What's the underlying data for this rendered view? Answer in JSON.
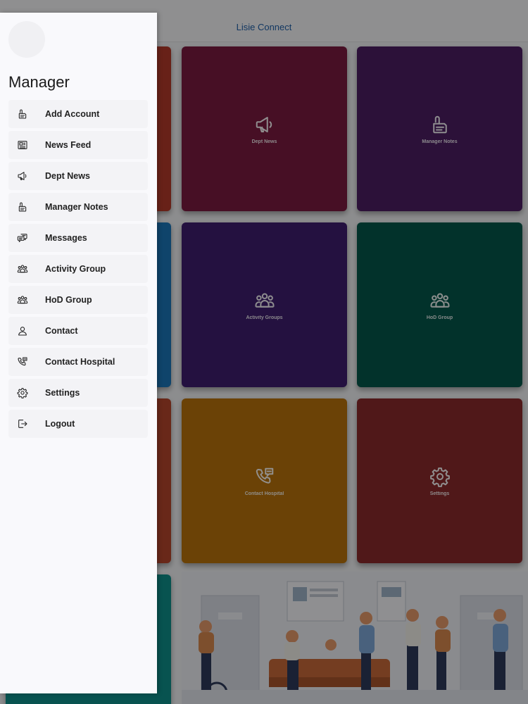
{
  "app": {
    "title": "Lisie Connect"
  },
  "tiles": [
    {
      "label": "Dept News",
      "icon": "megaphone-icon",
      "color": "#7a1b40"
    },
    {
      "label": "Manager Notes",
      "icon": "notes-icon",
      "color": "#4d1e63"
    },
    {
      "label": "Activity Groups",
      "icon": "group-icon",
      "color": "#3f1e6e"
    },
    {
      "label": "HoD Group",
      "icon": "group-icon",
      "color": "#04574a"
    },
    {
      "label": "Contact Hospital",
      "icon": "phone-chat-icon",
      "color": "#b8730c"
    },
    {
      "label": "Settings",
      "icon": "gear-icon",
      "color": "#8a2a2c"
    }
  ],
  "drawer": {
    "title": "Manager",
    "items": [
      {
        "label": "Add Account",
        "icon": "notes-icon"
      },
      {
        "label": "News Feed",
        "icon": "newspaper-icon"
      },
      {
        "label": "Dept News",
        "icon": "megaphone-icon"
      },
      {
        "label": "Manager Notes",
        "icon": "notes-icon"
      },
      {
        "label": "Messages",
        "icon": "messages-icon"
      },
      {
        "label": "Activity Group",
        "icon": "group-icon"
      },
      {
        "label": "HoD Group",
        "icon": "group-icon"
      },
      {
        "label": "Contact",
        "icon": "person-icon"
      },
      {
        "label": "Contact Hospital",
        "icon": "phone-chat-icon"
      },
      {
        "label": "Settings",
        "icon": "gear-icon"
      },
      {
        "label": "Logout",
        "icon": "logout-icon"
      }
    ]
  }
}
